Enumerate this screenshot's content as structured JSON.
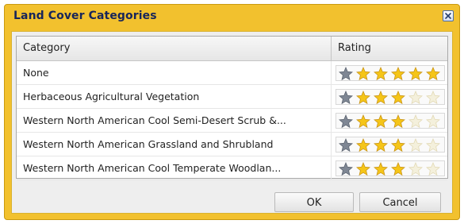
{
  "dialog": {
    "title": "Land Cover Categories",
    "close_icon": "close-icon"
  },
  "grid": {
    "columns": [
      "Category",
      "Rating"
    ],
    "rows": [
      {
        "category": "None",
        "rating": 1,
        "max": 6
      },
      {
        "category": "Herbaceous Agricultural Vegetation",
        "rating": 1,
        "max": 6
      },
      {
        "category": "Western North American Cool Semi-Desert Scrub &...",
        "rating": 1,
        "max": 6
      },
      {
        "category": "Western North American Grassland and Shrubland",
        "rating": 1,
        "max": 6
      },
      {
        "category": "Western North American Cool Temperate Woodlan...",
        "rating": 1,
        "max": 6
      }
    ],
    "star_fill_states": [
      [
        "gray",
        "gold",
        "gold",
        "gold",
        "gold",
        "gold"
      ],
      [
        "gray",
        "gold",
        "gold",
        "gold",
        "faded",
        "faded"
      ],
      [
        "gray",
        "gold",
        "gold",
        "gold",
        "faded",
        "faded"
      ],
      [
        "gray",
        "gold",
        "gold",
        "gold",
        "faded",
        "faded"
      ],
      [
        "gray",
        "gold",
        "gold",
        "gold",
        "faded",
        "faded"
      ]
    ]
  },
  "buttons": {
    "ok": "OK",
    "cancel": "Cancel"
  },
  "colors": {
    "frame": "#f2c12e",
    "title_text": "#17255a",
    "star_gold": "#f5c518",
    "star_gray": "#7f8794",
    "star_faded": "#f4f0dc"
  }
}
